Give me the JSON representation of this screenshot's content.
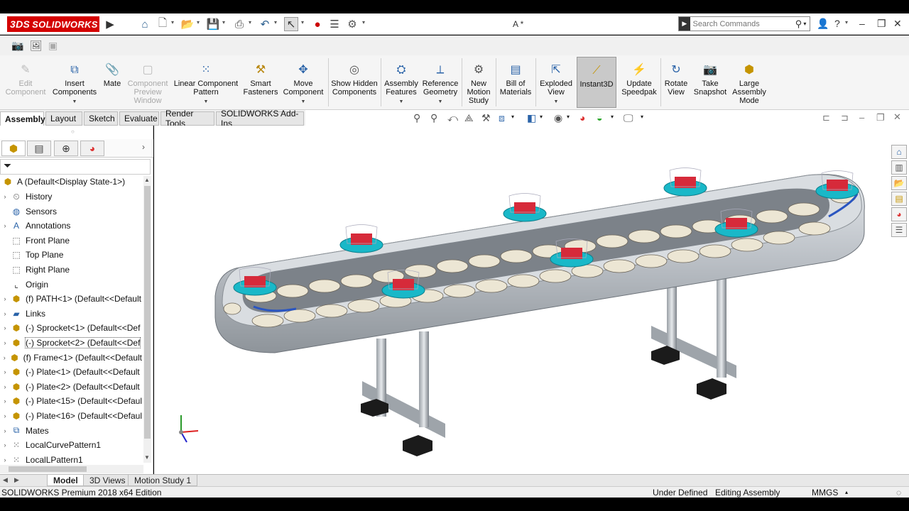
{
  "app": {
    "brand": "SOLIDWORKS",
    "brand_prefix": "3DS",
    "document_title": "A *"
  },
  "quick_access": {
    "search_placeholder": "Search Commands"
  },
  "ribbon": [
    {
      "label": "Edit Component",
      "disabled": true
    },
    {
      "label": "Insert Components"
    },
    {
      "label": "Mate"
    },
    {
      "label": "Component Preview Window",
      "disabled": true
    },
    {
      "label": "Linear Component Pattern"
    },
    {
      "label": "Smart Fasteners"
    },
    {
      "label": "Move Component"
    },
    {
      "label": "Show Hidden Components"
    },
    {
      "label": "Assembly Features"
    },
    {
      "label": "Reference Geometry"
    },
    {
      "label": "New Motion Study"
    },
    {
      "label": "Bill of Materials"
    },
    {
      "label": "Exploded View"
    },
    {
      "label": "Instant3D",
      "active": true
    },
    {
      "label": "Update Speedpak"
    },
    {
      "label": "Rotate View"
    },
    {
      "label": "Take Snapshot"
    },
    {
      "label": "Large Assembly Mode"
    }
  ],
  "command_tabs": [
    "Assembly",
    "Layout",
    "Sketch",
    "Evaluate",
    "Render Tools",
    "SOLIDWORKS Add-Ins"
  ],
  "feature_tree": {
    "root": "A  (Default<Display State-1>)",
    "items": [
      {
        "label": "History",
        "expand": true
      },
      {
        "label": "Sensors",
        "expand": false
      },
      {
        "label": "Annotations",
        "expand": true
      },
      {
        "label": "Front Plane",
        "expand": false
      },
      {
        "label": "Top Plane",
        "expand": false
      },
      {
        "label": "Right Plane",
        "expand": false
      },
      {
        "label": "Origin",
        "expand": false
      },
      {
        "label": "(f) PATH<1> (Default<<Default",
        "expand": true
      },
      {
        "label": "Links",
        "expand": true
      },
      {
        "label": "(-) Sprocket<1> (Default<<Def",
        "expand": true
      },
      {
        "label": "(-) Sprocket<2> (Default<<Def",
        "expand": true,
        "selected": true
      },
      {
        "label": "(f) Frame<1> (Default<<Default",
        "expand": true
      },
      {
        "label": "(-) Plate<1> (Default<<Default",
        "expand": true
      },
      {
        "label": "(-) Plate<2> (Default<<Default",
        "expand": true
      },
      {
        "label": "(-) Plate<15> (Default<<Defaul",
        "expand": true
      },
      {
        "label": "(-) Plate<16> (Default<<Defaul",
        "expand": true
      },
      {
        "label": "Mates",
        "expand": true
      },
      {
        "label": "LocalCurvePattern1",
        "expand": true
      },
      {
        "label": "LocalLPattern1",
        "expand": true
      }
    ]
  },
  "bottom_tabs": [
    "Model",
    "3D Views",
    "Motion Study 1"
  ],
  "status_bar": {
    "edition": "SOLIDWORKS Premium 2018 x64 Edition",
    "state": "Under Defined",
    "mode": "Editing Assembly",
    "units": "MMGS"
  },
  "colors": {
    "brand_red": "#d40000",
    "accent_blue": "#2a63a8",
    "active_button": "#c9c9c9",
    "cup": "#19b8c8",
    "box": "#d62a3a"
  }
}
